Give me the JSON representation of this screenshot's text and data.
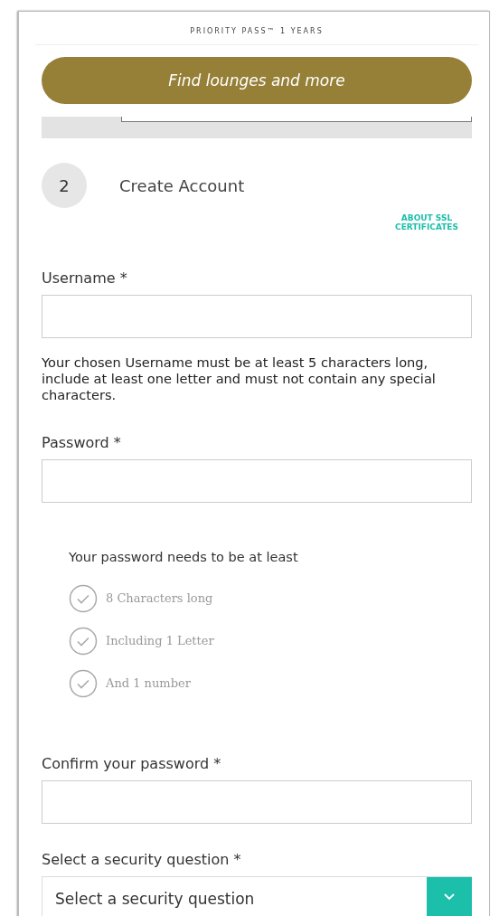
{
  "header": {
    "title": "PRIORITY PASS™ 1 YEARS"
  },
  "find_button": {
    "label": "Find lounges and more"
  },
  "step": {
    "number": "2",
    "title": "Create Account"
  },
  "ssl_link": {
    "label": "ABOUT SSL CERTIFICATES"
  },
  "fields": [
    {
      "kind": "text",
      "label": "Username *",
      "help": "Your chosen Username must be at least 5 characters long, include at least one letter and must not contain any special characters."
    },
    {
      "kind": "password",
      "label": "Password *",
      "requirements_title": "Your password needs to be at least",
      "requirements": [
        {
          "label": "8 Characters long",
          "met": false
        },
        {
          "label": "Including 1 Letter",
          "met": false
        },
        {
          "label": "And 1 number",
          "met": false
        }
      ]
    },
    {
      "kind": "password",
      "label": "Confirm your password *"
    },
    {
      "kind": "select",
      "label": "Select a security question *",
      "value": "Select a security question"
    }
  ]
}
